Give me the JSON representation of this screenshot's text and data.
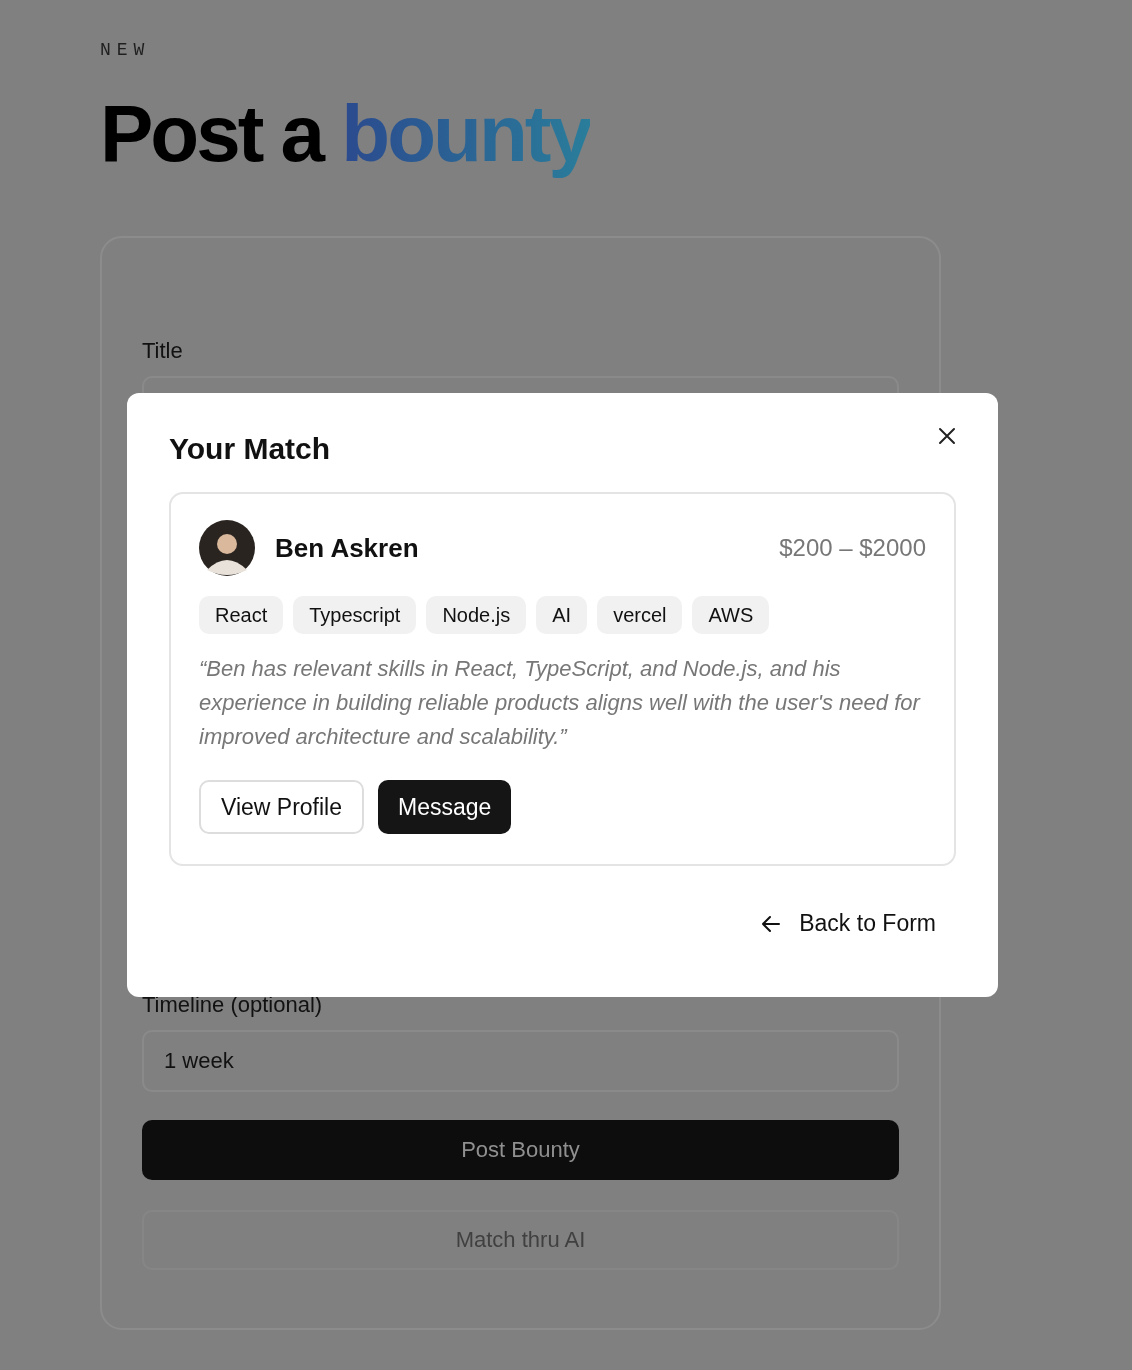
{
  "header": {
    "eyebrow": "NEW",
    "heading": "Post a",
    "heading_highlight": "bounty"
  },
  "form": {
    "fields": [
      {
        "label": "Title"
      },
      {
        "label": "Timeline (optional)",
        "value": "1 week"
      }
    ],
    "buttons": [
      {
        "label": "Post Bounty",
        "kind": "primary"
      },
      {
        "label": "Match thru AI",
        "kind": "secondary"
      }
    ]
  },
  "modal": {
    "title": "Your Match",
    "match": {
      "name": "Ben Askren",
      "price": "$200 – $2000",
      "tags": [
        "React",
        "Typescript",
        "Node.js",
        "AI",
        "vercel",
        "AWS"
      ],
      "reason": "“Ben has relevant skills in React, TypeScript, and Node.js, and his experience in building reliable products aligns well with the user's need for improved architecture and scalability.”",
      "actions": [
        {
          "label": "View Profile",
          "kind": "secondary"
        },
        {
          "label": "Message",
          "kind": "primary"
        }
      ]
    },
    "back": "Back to Form"
  }
}
